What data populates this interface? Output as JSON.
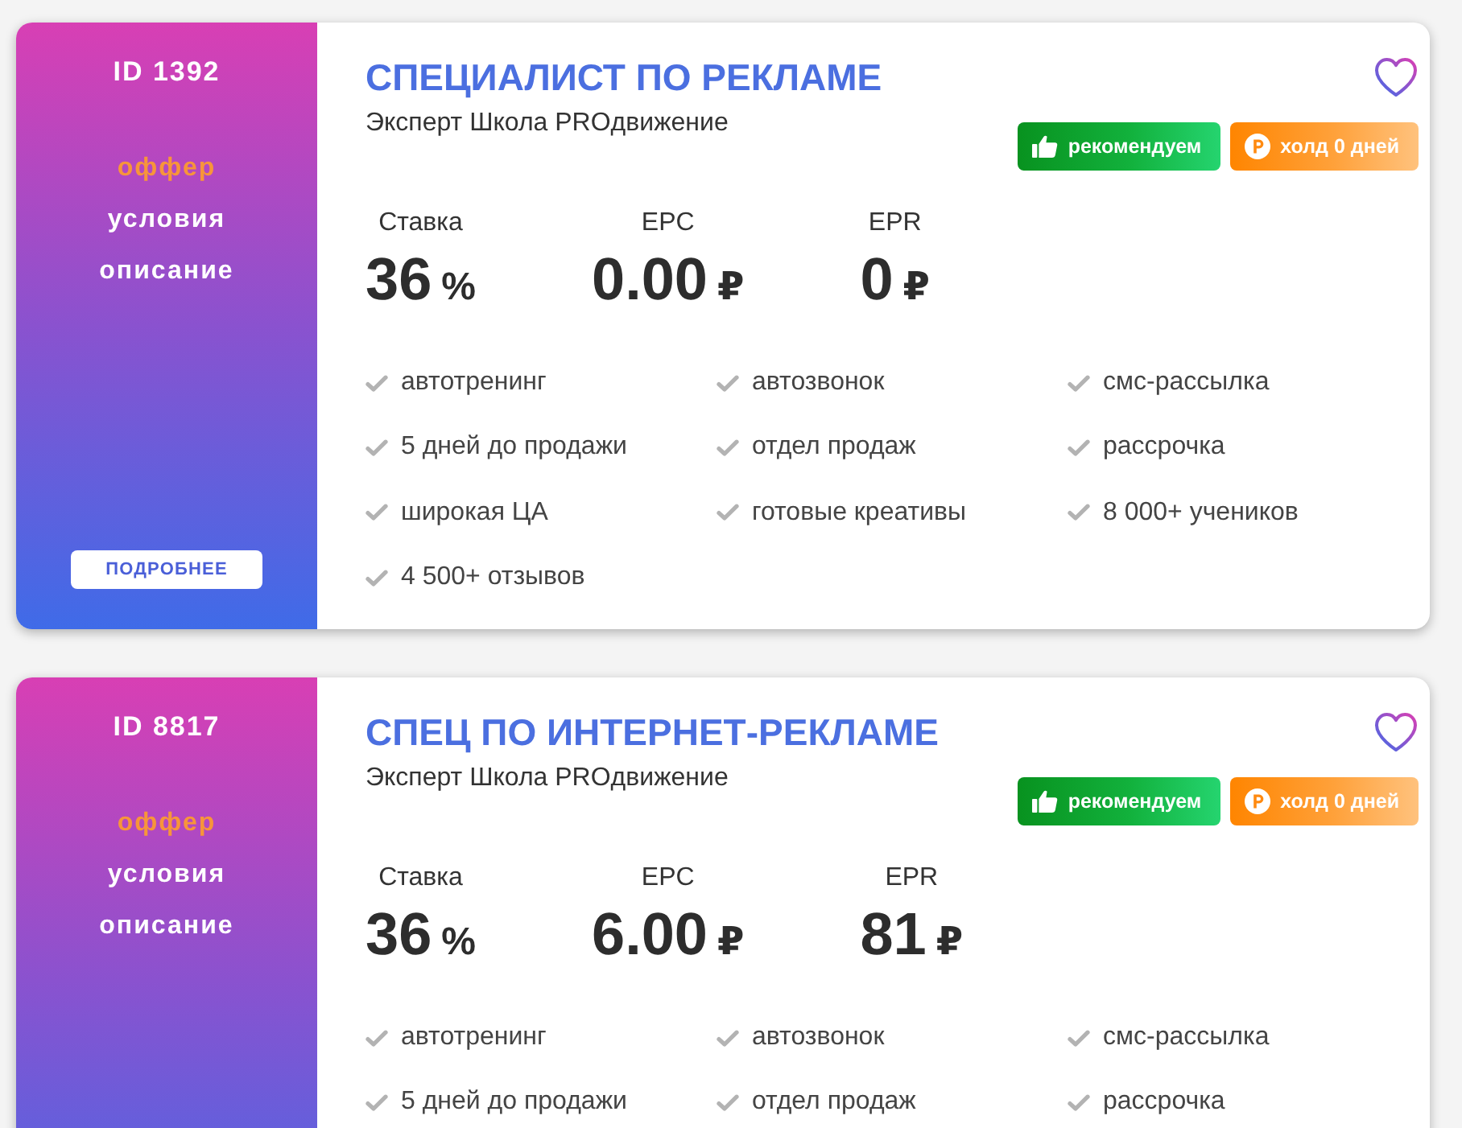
{
  "offers": [
    {
      "id_label": "ID 1392",
      "menu": [
        {
          "label": "оффер",
          "selected": true
        },
        {
          "label": "условия",
          "selected": false
        },
        {
          "label": "описание",
          "selected": false
        }
      ],
      "more_button": "ПОДРОБНЕЕ",
      "title": "СПЕЦИАЛИСТ ПО РЕКЛАМЕ",
      "subtitle": "Эксперт Школа PROдвижение",
      "favorite": false,
      "badges": [
        {
          "kind": "recommend",
          "label": "рекомендуем"
        },
        {
          "kind": "hold",
          "label": "холд 0 дней"
        }
      ],
      "stats": [
        {
          "label": "Ставка",
          "value": "36",
          "unit": "%"
        },
        {
          "label": "EPC",
          "value": "0.00",
          "unit": "₽"
        },
        {
          "label": "EPR",
          "value": "0",
          "unit": "₽"
        }
      ],
      "features": [
        "автотренинг",
        "автозвонок",
        "смс-рассылка",
        "5 дней до продажи",
        "отдел продаж",
        "рассрочка",
        "широкая ЦА",
        "готовые креативы",
        "8 000+ учеников",
        "4 500+ отзывов"
      ]
    },
    {
      "id_label": "ID 8817",
      "menu": [
        {
          "label": "оффер",
          "selected": true
        },
        {
          "label": "условия",
          "selected": false
        },
        {
          "label": "описание",
          "selected": false
        }
      ],
      "title": "СПЕЦ ПО ИНТЕРНЕТ-РЕКЛАМЕ",
      "subtitle": "Эксперт Школа PROдвижение",
      "favorite": false,
      "badges": [
        {
          "kind": "recommend",
          "label": "рекомендуем"
        },
        {
          "kind": "hold",
          "label": "холд 0 дней"
        }
      ],
      "stats": [
        {
          "label": "Ставка",
          "value": "36",
          "unit": "%"
        },
        {
          "label": "EPC",
          "value": "6.00",
          "unit": "₽"
        },
        {
          "label": "EPR",
          "value": "81",
          "unit": "₽"
        }
      ],
      "features": [
        "автотренинг",
        "автозвонок",
        "смс-рассылка",
        "5 дней до продажи",
        "отдел продаж",
        "рассрочка"
      ]
    }
  ]
}
